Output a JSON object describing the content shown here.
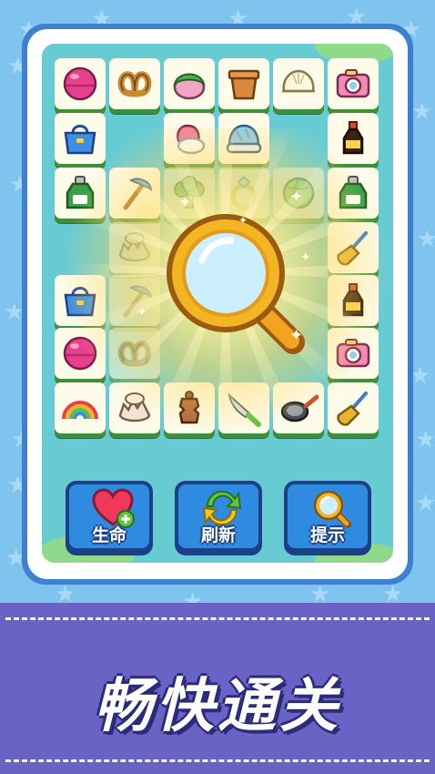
{
  "board": {
    "tiles": [
      {
        "icon": "macaron-icon"
      },
      {
        "icon": "pretzel-icon"
      },
      {
        "icon": "rice-cake-icon"
      },
      {
        "icon": "flower-pot-icon"
      },
      {
        "icon": "steamed-bun-icon"
      },
      {
        "icon": "camera-icon"
      },
      {
        "icon": "handbag-icon"
      },
      {
        "icon": "mitten-icon"
      },
      {
        "icon": "knit-hat-icon"
      },
      {
        "icon": "soy-sauce-bottle-icon"
      },
      {
        "icon": "perfume-bottle-icon"
      },
      {
        "icon": "pickaxe-icon"
      },
      {
        "icon": "broccoli-icon"
      },
      {
        "icon": "ring-icon"
      },
      {
        "icon": "cabbage-icon"
      },
      {
        "icon": "perfume-bottle-icon"
      },
      {
        "icon": "eggshell-icon"
      },
      {
        "icon": "broom-icon"
      },
      {
        "icon": "handbag-icon"
      },
      {
        "icon": "pickaxe-icon"
      },
      {
        "icon": "soy-sauce-bottle-icon"
      },
      {
        "icon": "macaron-icon"
      },
      {
        "icon": "pretzel-icon"
      },
      {
        "icon": "camera-icon"
      },
      {
        "icon": "rainbow-icon"
      },
      {
        "icon": "eggshell-icon"
      },
      {
        "icon": "pepper-grinder-icon"
      },
      {
        "icon": "knife-icon"
      },
      {
        "icon": "frying-pan-icon"
      },
      {
        "icon": "broom-icon"
      }
    ],
    "hint_icon": "magnifier-icon"
  },
  "actions": [
    {
      "label": "生命",
      "icon": "heart-plus-icon"
    },
    {
      "label": "刷新",
      "icon": "refresh-icon"
    },
    {
      "label": "提示",
      "icon": "magnifier-icon"
    }
  ],
  "banner": {
    "slogan": "畅快通关"
  },
  "colors": {
    "background": "#7ec4ef",
    "board": "#67cbd3",
    "frame": "#3f7fd0",
    "tile_face": "#fdfbe9",
    "tile_edge": "#3f8f3a",
    "button": "#2f8be0",
    "button_border": "#1c3f86",
    "banner": "#6a63c6"
  }
}
